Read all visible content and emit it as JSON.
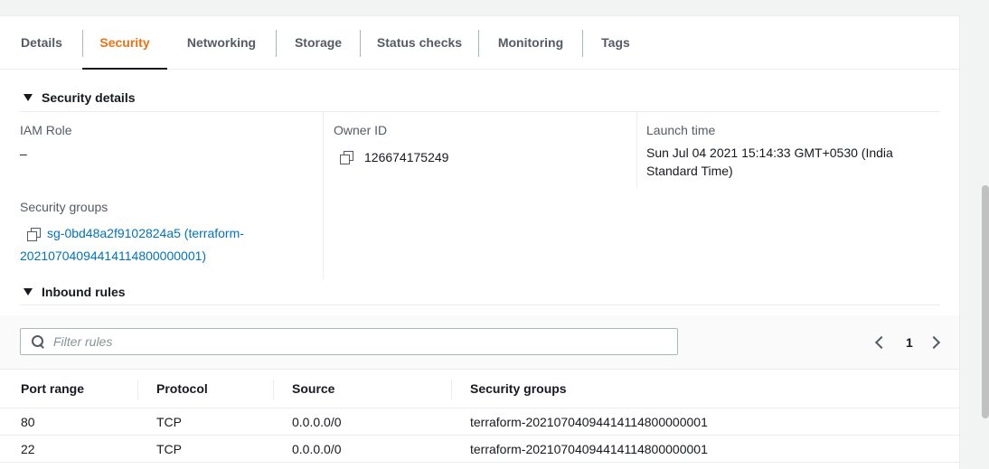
{
  "tabs": [
    {
      "label": "Details"
    },
    {
      "label": "Security"
    },
    {
      "label": "Networking"
    },
    {
      "label": "Storage"
    },
    {
      "label": "Status checks"
    },
    {
      "label": "Monitoring"
    },
    {
      "label": "Tags"
    }
  ],
  "active_tab": "Security",
  "accent_color": "#ec7211",
  "link_color": "#0073bb",
  "security_details": {
    "title": "Security details",
    "iam_role_label": "IAM Role",
    "iam_role_value": "–",
    "owner_id_label": "Owner ID",
    "owner_id_value": "126674175249",
    "launch_time_label": "Launch time",
    "launch_time_line1": "Sun Jul 04 2021 15:14:33 GMT+0530 (India",
    "launch_time_line2": "Standard Time)",
    "security_groups_label": "Security groups",
    "security_group_line1": "sg-0bd48a2f9102824a5 (terraform-",
    "security_group_line2": "20210704094414114800000001)"
  },
  "inbound_rules": {
    "title": "Inbound rules",
    "filter_placeholder": "Filter rules",
    "filter_value": "",
    "page": "1",
    "columns": [
      "Port range",
      "Protocol",
      "Source",
      "Security groups"
    ],
    "rows": [
      [
        "80",
        "TCP",
        "0.0.0.0/0",
        "terraform-20210704094414114800000001"
      ],
      [
        "22",
        "TCP",
        "0.0.0.0/0",
        "terraform-20210704094414114800000001"
      ]
    ]
  },
  "icons": [
    "caret-down-icon",
    "copy-icon",
    "search-icon",
    "chevron-left-icon",
    "chevron-right-icon"
  ]
}
